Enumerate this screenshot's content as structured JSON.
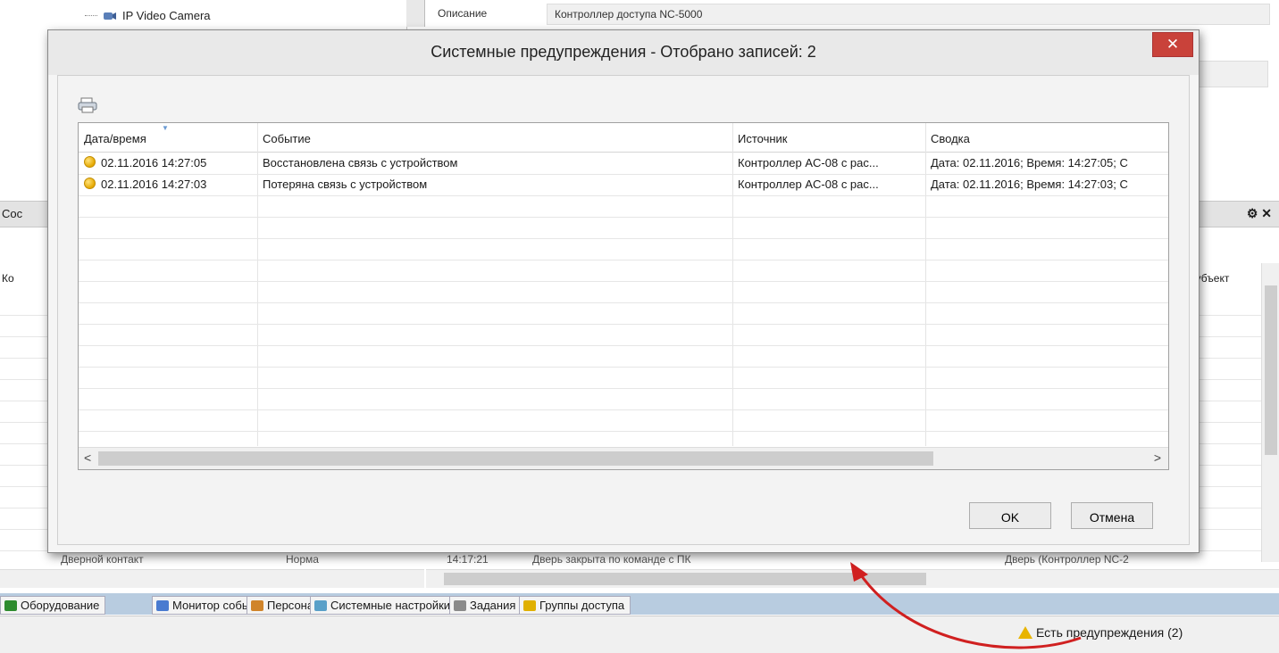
{
  "background": {
    "tree_item": "IP Video Camera",
    "props_label": "Описание",
    "props_value": "Контроллер доступа NC-5000",
    "panel_header_left": "Сос",
    "col_ko": "Ко",
    "col_subject": "Субъект",
    "row_left_name": "Дверной контакт",
    "row_left_state": "Норма",
    "row_right_time": "14:17:21",
    "row_right_text": "Дверь закрыта по команде с ПК",
    "row_right_source": "Дверь (Контроллер NC-2"
  },
  "tabs": [
    {
      "label": "Оборудование",
      "color": "#2e8b2e"
    },
    {
      "label": "Монитор событий",
      "color": "#4a7bd0"
    },
    {
      "label": "Персонал",
      "color": "#d0842a"
    },
    {
      "label": "Системные настройки",
      "color": "#5aa0c8"
    },
    {
      "label": "Задания",
      "color": "#8a8a8a"
    },
    {
      "label": "Группы доступа",
      "color": "#e0b000"
    }
  ],
  "status_warning": "Есть предупреждения (2)",
  "dialog": {
    "title": "Системные предупреждения - Отобрано записей: 2",
    "close_glyph": "✕",
    "columns": [
      "Дата/время",
      "Событие",
      "Источник",
      "Сводка"
    ],
    "rows": [
      {
        "datetime": "02.11.2016 14:27:05",
        "event": "Восстановлена связь с устройством",
        "source": "Контроллер AC-08 с рас...",
        "summary": "Дата: 02.11.2016; Время: 14:27:05; С"
      },
      {
        "datetime": "02.11.2016 14:27:03",
        "event": "Потеряна связь с устройством",
        "source": "Контроллер AC-08 с рас...",
        "summary": "Дата: 02.11.2016; Время: 14:27:03; С"
      }
    ],
    "ok_label": "OK",
    "cancel_label": "Отмена",
    "status_color": "#e5a800"
  },
  "colors": {
    "accent_close": "#c9423a",
    "tabbar": "#b8cce0",
    "arrow": "#d02020"
  }
}
